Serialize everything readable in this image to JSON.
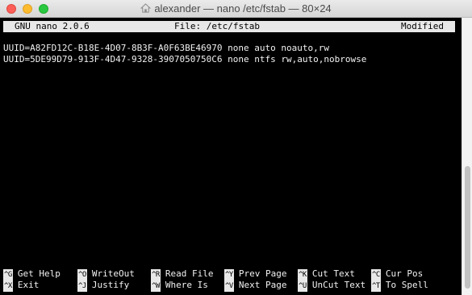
{
  "window": {
    "title": "alexander — nano /etc/fstab — 80×24",
    "title_icon": "home-folder-icon"
  },
  "nano": {
    "header": {
      "version": "GNU nano 2.0.6",
      "file": "File: /etc/fstab",
      "status": "Modified"
    },
    "lines": [
      "UUID=A82FD12C-B18E-4D07-8B3F-A0F63BE46970 none auto noauto,rw",
      "UUID=5DE99D79-913F-4D47-9328-3907050750C6 none ntfs rw,auto,nobrowse"
    ],
    "shortcuts": {
      "row1": [
        {
          "key": "^G",
          "label": "Get Help"
        },
        {
          "key": "^O",
          "label": "WriteOut"
        },
        {
          "key": "^R",
          "label": "Read File"
        },
        {
          "key": "^Y",
          "label": "Prev Page"
        },
        {
          "key": "^K",
          "label": "Cut Text"
        },
        {
          "key": "^C",
          "label": "Cur Pos"
        }
      ],
      "row2": [
        {
          "key": "^X",
          "label": "Exit"
        },
        {
          "key": "^J",
          "label": "Justify"
        },
        {
          "key": "^W",
          "label": "Where Is"
        },
        {
          "key": "^V",
          "label": "Next Page"
        },
        {
          "key": "^U",
          "label": "UnCut Text"
        },
        {
          "key": "^T",
          "label": "To Spell"
        }
      ]
    }
  },
  "colors": {
    "terminal_bg": "#000000",
    "terminal_fg": "#f2f2f2",
    "highlight_bg": "#e8e8e8",
    "close": "#fc5f57",
    "minimize": "#fdbc2e",
    "maximize": "#29c840"
  }
}
